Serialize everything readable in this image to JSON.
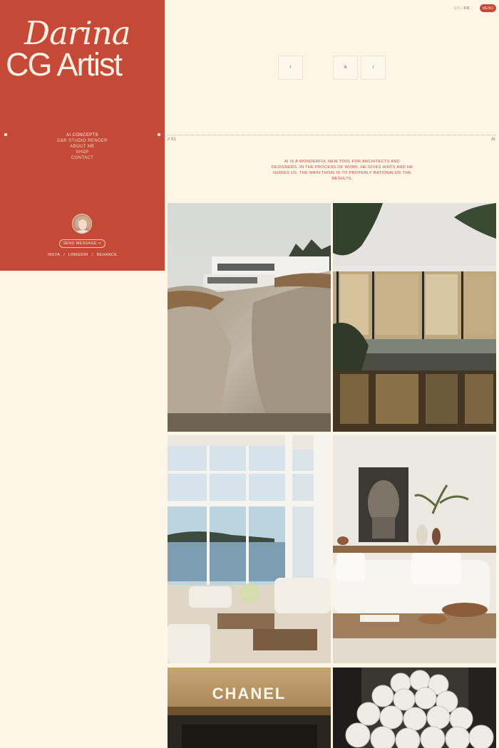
{
  "logo": {
    "line1": "Darina",
    "line2": "CG Artist"
  },
  "nav": {
    "items": [
      {
        "label": "AI CONCEPTS",
        "active": true
      },
      {
        "label": "D&R STUDIO RENDER",
        "active": false
      },
      {
        "label": "ABOUT ME",
        "active": false
      },
      {
        "label": "SHOP",
        "active": false
      },
      {
        "label": "CONTACT",
        "active": false
      }
    ]
  },
  "profile": {
    "send_message_label": "SEND MESSAGE ↵"
  },
  "socials": {
    "insta": "INSTA",
    "linkedin": "LINKEDIN",
    "behance": "BEHANCE",
    "sep": "/"
  },
  "header": {
    "lang_en": "EN",
    "lang_sep": "/",
    "lang_fr": "FR",
    "menu_label": "MENU"
  },
  "filters": [
    "/",
    "A",
    "/"
  ],
  "section": {
    "number": "// 01",
    "tag": "AI",
    "intro": "AI IS A WONDERFUL NEW TOOL FOR ARCHITECTS AND DESIGNERS. IN THE PROCESS OF WORK, HE GIVES HINTS AND HE GUIDES US. THE MAIN THING IS TO PROPERLY RATIONALIZE THE RESULTS."
  },
  "gallery": {
    "chanel_sign": "CHANEL"
  },
  "colors": {
    "brand_red": "#c44a37",
    "cream_bg": "#fdf5e6",
    "text_light": "#fbe9d9"
  }
}
